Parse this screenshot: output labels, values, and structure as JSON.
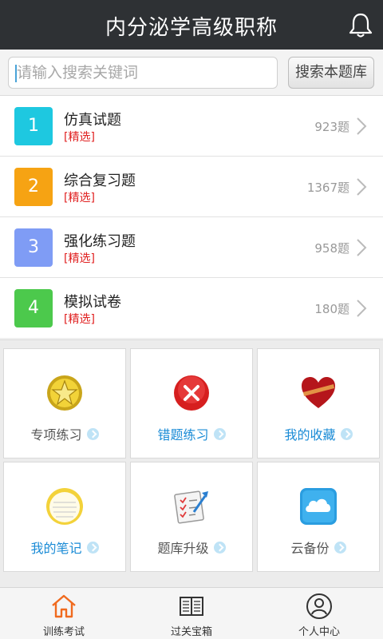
{
  "header": {
    "title": "内分泌学高级职称",
    "bell_icon": "bell-icon"
  },
  "search": {
    "placeholder": "请输入搜索关键词",
    "button_label": "搜索本题库"
  },
  "list": [
    {
      "number": "1",
      "title": "仿真试题",
      "tag": "[精选]",
      "count": "923题",
      "color": "#1ec8e0"
    },
    {
      "number": "2",
      "title": "综合复习题",
      "tag": "[精选]",
      "count": "1367题",
      "color": "#f6a313"
    },
    {
      "number": "3",
      "title": "强化练习题",
      "tag": "[精选]",
      "count": "958题",
      "color": "#7f9cf5"
    },
    {
      "number": "4",
      "title": "模拟试卷",
      "tag": "[精选]",
      "count": "180题",
      "color": "#4cc94c"
    }
  ],
  "grid": [
    {
      "label": "专项练习",
      "icon": "star-medal-icon",
      "highlight": false
    },
    {
      "label": "错题练习",
      "icon": "wrong-x-icon",
      "highlight": true
    },
    {
      "label": "我的收藏",
      "icon": "heart-favorite-icon",
      "highlight": true
    },
    {
      "label": "我的笔记",
      "icon": "notepad-icon",
      "highlight": true
    },
    {
      "label": "题库升级",
      "icon": "checklist-upgrade-icon",
      "highlight": false
    },
    {
      "label": "云备份",
      "icon": "cloud-backup-icon",
      "highlight": false
    }
  ],
  "nav": [
    {
      "label": "训练考试",
      "icon": "home-icon",
      "active": true
    },
    {
      "label": "过关宝箱",
      "icon": "book-icon",
      "active": false
    },
    {
      "label": "个人中心",
      "icon": "user-icon",
      "active": false
    }
  ],
  "colors": {
    "header_bg": "#2e3134",
    "accent_blue": "#1a8bd6",
    "tag_red": "#e02020",
    "nav_active": "#f06a1e"
  }
}
